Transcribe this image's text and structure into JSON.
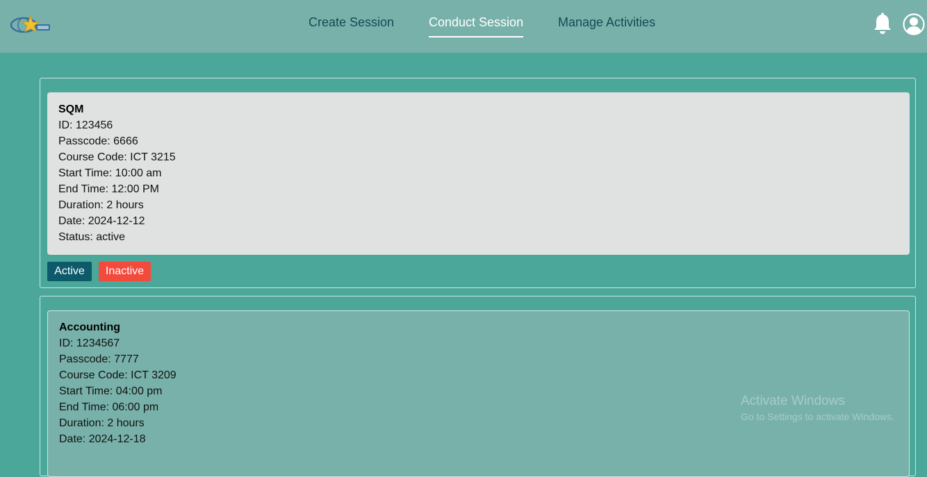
{
  "header": {
    "nav": [
      {
        "label": "Create Session"
      },
      {
        "label": "Conduct Session",
        "active": true
      },
      {
        "label": "Manage Activities"
      }
    ],
    "icons": {
      "notifications": "bell-icon",
      "profile": "user-circle-icon",
      "logo": "star-globe-logo"
    }
  },
  "sessions": [
    {
      "name": "SQM",
      "id": "ID: 123456",
      "passcode": "Passcode: 6666",
      "course_code": "Course Code: ICT 3215",
      "start_time": "Start Time: 10:00 am",
      "end_time": "End Time: 12:00 PM",
      "duration": "Duration: 2 hours",
      "date": "Date: 2024-12-12",
      "status": "Status: active",
      "active_label": "Active",
      "inactive_label": "Inactive"
    },
    {
      "name": "Accounting",
      "id": "ID: 1234567",
      "passcode": "Passcode: 7777",
      "course_code": "Course Code: ICT 3209",
      "start_time": "Start Time: 04:00 pm",
      "end_time": "End Time: 06:00 pm",
      "duration": "Duration: 2 hours",
      "date": "Date: 2024-12-18"
    }
  ],
  "watermark": {
    "line1": "Activate Windows",
    "line2": "Go to Settings to activate Windows."
  },
  "colors": {
    "background": "#4aa79a",
    "header": "#78b1aa",
    "active_button": "#0d5a6b",
    "inactive_button": "#f24a3c"
  }
}
